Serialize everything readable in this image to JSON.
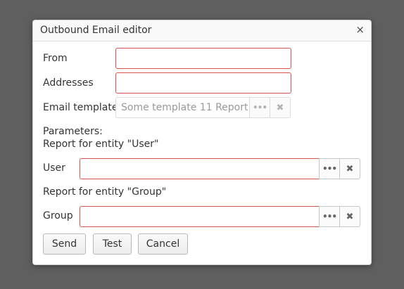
{
  "dialog": {
    "title": "Outbound Email editor",
    "close_glyph": "×"
  },
  "form": {
    "from_label": "From",
    "from_value": "",
    "addresses_label": "Addresses",
    "addresses_value": "",
    "template_label": "Email template",
    "template_value": "Some template 11  Report",
    "parameters_label": "Parameters:",
    "report_user_label": "Report for entity \"User\"",
    "user_label": "User",
    "user_value": "",
    "report_group_label": "Report for entity \"Group\"",
    "group_label": "Group",
    "group_value": ""
  },
  "icons": {
    "lookup": "ellipsis-icon",
    "clear": "clear-icon",
    "lookup_glyph": "•••",
    "clear_glyph": "✖"
  },
  "buttons": {
    "send": "Send",
    "test": "Test",
    "cancel": "Cancel"
  },
  "colors": {
    "required_border": "#d9534f",
    "backdrop": "#5f5f5f"
  }
}
